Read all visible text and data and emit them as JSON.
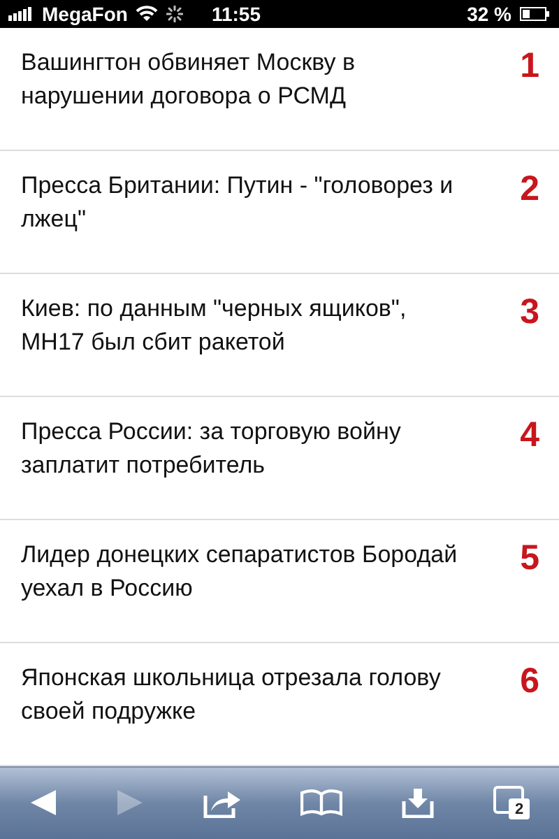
{
  "status_bar": {
    "carrier": "MegaFon",
    "time": "11:55",
    "battery": "32 %"
  },
  "articles": [
    {
      "title": "Вашингтон обвиняет Москву в нарушении договора о РСМД",
      "number": "1"
    },
    {
      "title": "Пресса Британии: Путин - \"головорез и лжец\"",
      "number": "2"
    },
    {
      "title": "Киев: по данным \"черных ящиков\", MH17 был сбит ракетой",
      "number": "3"
    },
    {
      "title": "Пресса России: за торговую войну заплатит потребитель",
      "number": "4"
    },
    {
      "title": "Лидер донецких сепаратистов Бородай уехал в Россию",
      "number": "5"
    },
    {
      "title": "Японская школьница отрезала голову своей подружке",
      "number": "6"
    }
  ],
  "toolbar": {
    "buttons": [
      {
        "kind": "back",
        "disabled": false
      },
      {
        "kind": "forward",
        "disabled": true
      },
      {
        "kind": "share",
        "disabled": false
      },
      {
        "kind": "bookmarks",
        "disabled": false
      },
      {
        "kind": "download",
        "disabled": false
      },
      {
        "kind": "tabs",
        "disabled": false,
        "count": "2"
      }
    ]
  }
}
